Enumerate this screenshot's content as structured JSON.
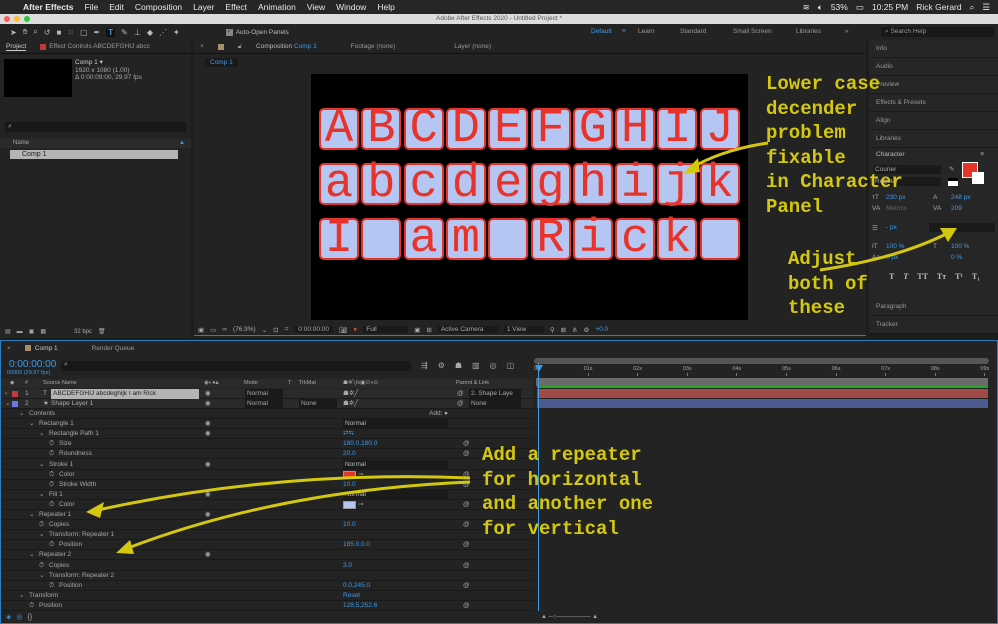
{
  "menubar": {
    "app": "After Effects",
    "items": [
      "File",
      "Edit",
      "Composition",
      "Layer",
      "Effect",
      "Animation",
      "View",
      "Window",
      "Help"
    ],
    "battery": "53%",
    "time": "10:25 PM",
    "user": "Rick Gerard"
  },
  "titlebar": {
    "title": "Adobe After Effects 2020 - Untitled Project *"
  },
  "toolbar": {
    "auto_open_label": "Auto-Open Panels",
    "auto_open_checked": true,
    "active_tool": "type-tool"
  },
  "workspaces": {
    "items": [
      "Default",
      "Learn",
      "Standard",
      "Small Screen",
      "Libraries"
    ],
    "active": "Default",
    "search_placeholder": "Search Help"
  },
  "project": {
    "tab": "Project",
    "effect_tab": "Effect Controls ABCDEFGHIJ abcc",
    "comp_name": "Comp 1 ▾",
    "comp_res": "1920 x 1080 (1.00)",
    "comp_dur": "Δ 0:00:09:00, 29.97 fps",
    "col_name": "Name",
    "item": "Comp 1",
    "bpc": "32 bpc"
  },
  "viewer": {
    "tab": "Composition",
    "tab_comp": "Comp 1",
    "footage_tab": "Footage (none)",
    "layer_tab": "Layer (none)",
    "breadcrumb": "Comp 1",
    "zoom": "(76.9%)",
    "time": "0:00:00:00",
    "resolution": "Full",
    "camera": "Active Camera",
    "views": "1 View",
    "exposure": "+0.0",
    "rows": [
      "ABCDEFGHIJ",
      "abcdeghijk",
      "I am Rick "
    ]
  },
  "right_panels": {
    "top": [
      "Info",
      "Audio",
      "Preview",
      "Effects & Presets",
      "Align",
      "Libraries"
    ],
    "character_title": "Character",
    "font": "Courier",
    "style": "Regular",
    "size": "230 px",
    "leading": "248 px",
    "kerning": "Metrics",
    "tracking": "209",
    "stroke": "- px",
    "vscale": "100 %",
    "hscale": "100 %",
    "baseline": "0 px",
    "tsume": "0 %",
    "fill_color": "#e8332b",
    "bottom": [
      "Paragraph",
      "Tracker"
    ]
  },
  "timeline": {
    "tab": "Comp 1",
    "render_tab": "Render Queue",
    "time": "0:00:00:00",
    "frames": "00000 (29.97 fps)",
    "headers": {
      "source": "Source Name",
      "mode": "Mode",
      "t": "T",
      "trkmat": "TrkMat",
      "parent": "Parent & Link",
      "num": "#"
    },
    "layers": [
      {
        "num": "1",
        "name": "ABCDEFGHIJ abcdeghijk I am Rick",
        "mode": "Normal",
        "trkmat": "",
        "parent": "2. Shape Laye",
        "color": "#c23b3b",
        "type": "T"
      },
      {
        "num": "2",
        "name": "Shape Layer 1",
        "mode": "Normal",
        "trkmat": "None",
        "parent": "None",
        "color": "#6a78e0",
        "type": "★"
      }
    ],
    "add_label": "Add:",
    "props": [
      {
        "name": "Contents",
        "indent": 1,
        "twirl": true
      },
      {
        "name": "Rectangle 1",
        "indent": 2,
        "twirl": true,
        "eye": true,
        "value": "Normal",
        "dropdown": true
      },
      {
        "name": "Rectangle Path 1",
        "indent": 3,
        "twirl": true,
        "eye": true,
        "value": "⇄⇆"
      },
      {
        "name": "Size",
        "indent": 4,
        "stopwatch": true,
        "value": "180.0,180.0",
        "link": true
      },
      {
        "name": "Roundness",
        "indent": 4,
        "stopwatch": true,
        "value": "20.0",
        "link": true
      },
      {
        "name": "Stroke 1",
        "indent": 3,
        "twirl": true,
        "eye": true,
        "value": "Normal",
        "dropdown": true
      },
      {
        "name": "Color",
        "indent": 4,
        "stopwatch": true,
        "swatch": "#e8332b",
        "link": true
      },
      {
        "name": "Stroke Width",
        "indent": 4,
        "stopwatch": true,
        "value": "10.0",
        "link": true
      },
      {
        "name": "Fill 1",
        "indent": 3,
        "twirl": true,
        "eye": true,
        "value": "Normal",
        "dropdown": true
      },
      {
        "name": "Color",
        "indent": 4,
        "stopwatch": true,
        "swatch": "#b6c6f2",
        "link": true
      },
      {
        "name": "Repeater 1",
        "indent": 2,
        "twirl": true,
        "eye": true
      },
      {
        "name": "Copies",
        "indent": 3,
        "stopwatch": true,
        "value": "10.0",
        "link": true
      },
      {
        "name": "Transform: Repeater 1",
        "indent": 3,
        "twirl": true
      },
      {
        "name": "Position",
        "indent": 4,
        "stopwatch": true,
        "value": "185.0,0.0",
        "link": true
      },
      {
        "name": "Repeater 2",
        "indent": 2,
        "twirl": true,
        "eye": true
      },
      {
        "name": "Copies",
        "indent": 3,
        "stopwatch": true,
        "value": "3.0",
        "link": true
      },
      {
        "name": "Transform: Repeater 2",
        "indent": 3,
        "twirl": true
      },
      {
        "name": "Position",
        "indent": 4,
        "stopwatch": true,
        "value": "0.0,245.0",
        "link": true
      },
      {
        "name": "Transform",
        "indent": 1,
        "twirl": true,
        "value": "Reset"
      },
      {
        "name": "Position",
        "indent": 2,
        "stopwatch": true,
        "value": "128.5,252.6",
        "link": true
      }
    ],
    "ruler": [
      "0s",
      "01s",
      "02s",
      "03s",
      "04s",
      "05s",
      "06s",
      "07s",
      "08s",
      "09s"
    ]
  },
  "annotations": {
    "lowercase": "Lower case\ndecender\nproblem\nfixable\nin Character\nPanel",
    "adjust": "Adjust\nboth of\nthese",
    "repeater": "Add a repeater\nfor horizontal\nand another one\nfor vertical",
    "color": "#d4c80e"
  }
}
